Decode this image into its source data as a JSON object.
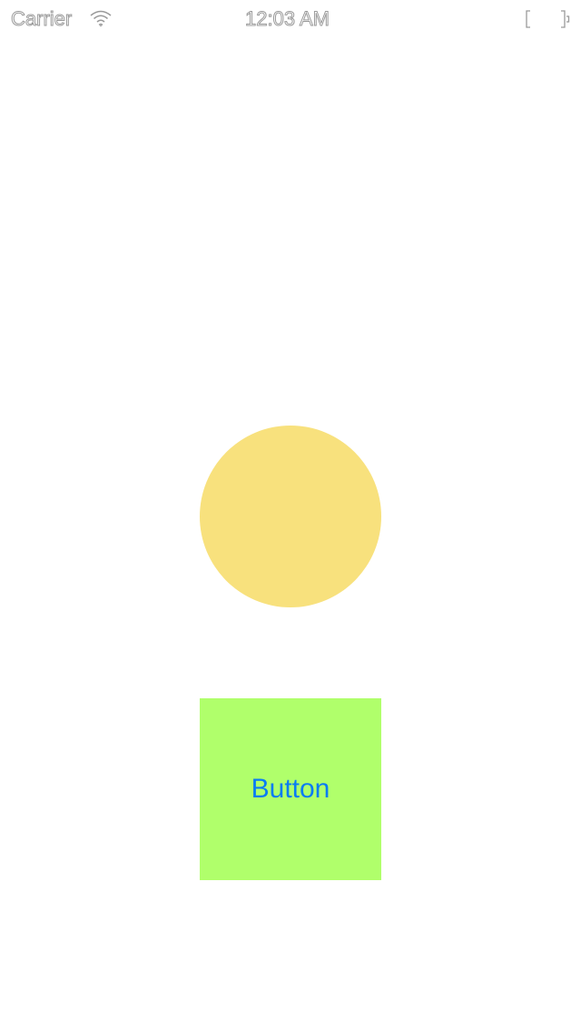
{
  "status_bar": {
    "carrier": "Carrier",
    "time": "12:03 AM",
    "wifi_icon": "wifi-icon",
    "battery_icon": "battery-icon"
  },
  "shapes": {
    "circle_color": "#f8e17d"
  },
  "button": {
    "label": "Button",
    "background_color": "#b0ff6b",
    "text_color": "#0a7cf3"
  }
}
